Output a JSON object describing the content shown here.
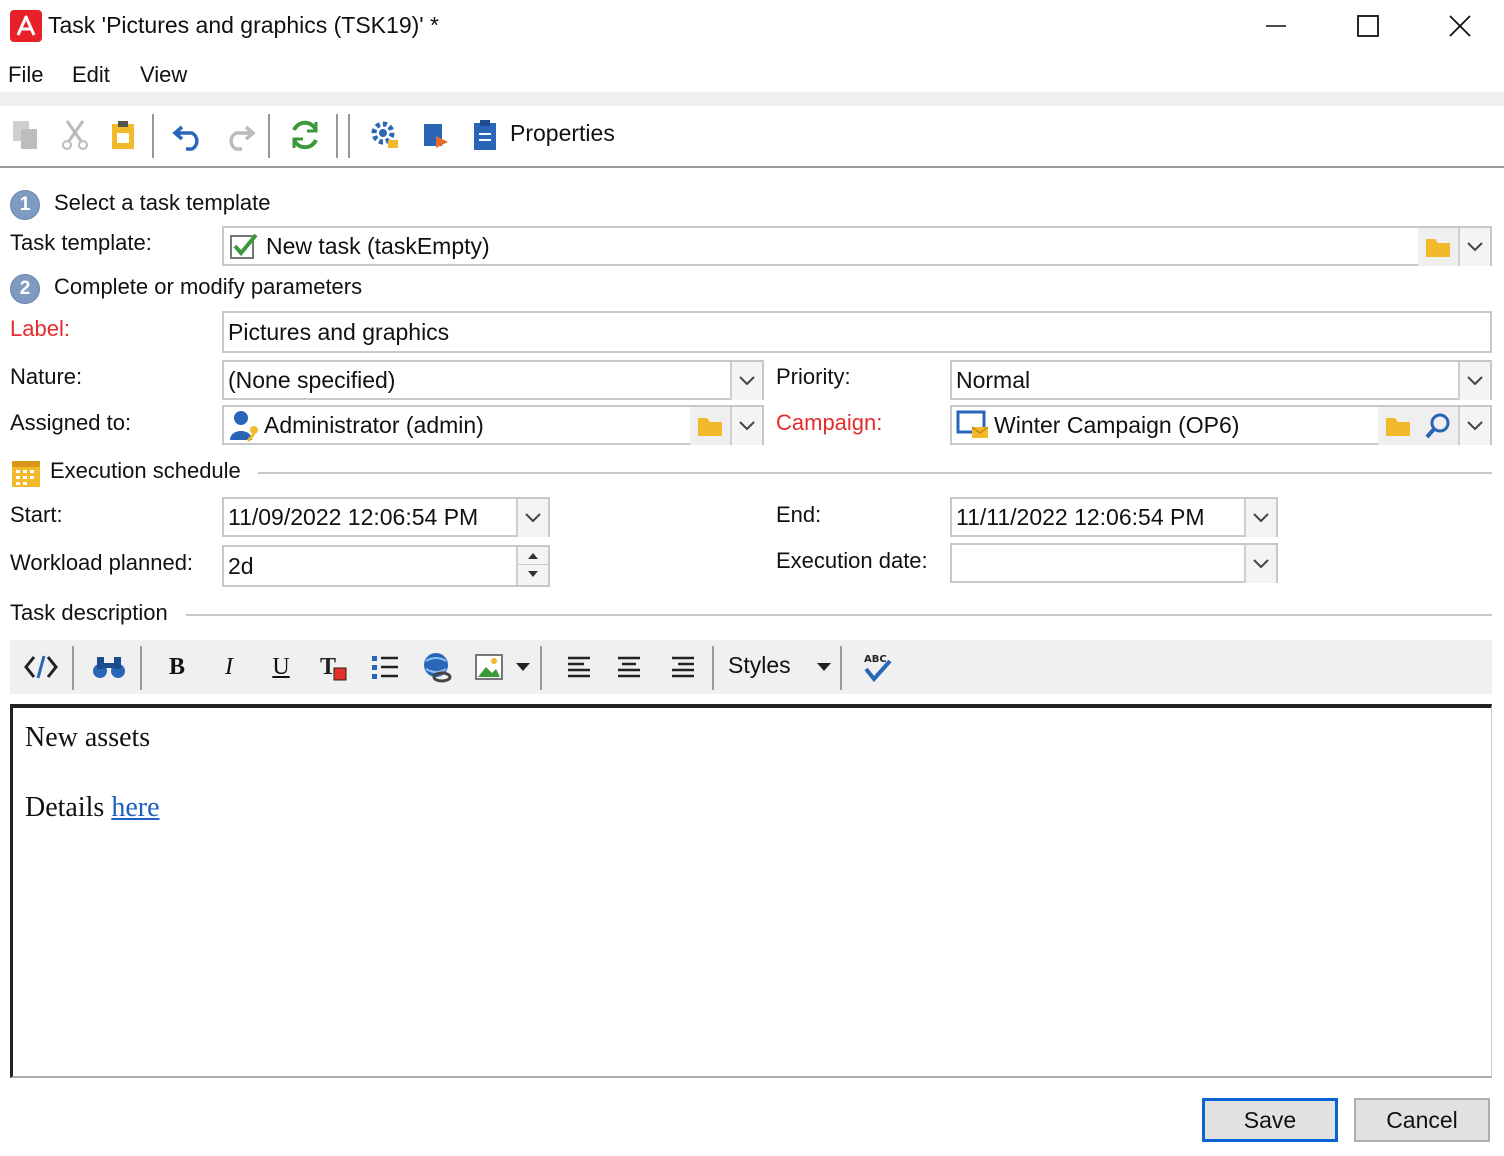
{
  "window": {
    "title": "Task 'Pictures and graphics (TSK19)' *"
  },
  "menu": [
    "File",
    "Edit",
    "View"
  ],
  "toolbar": {
    "properties_label": "Properties"
  },
  "step1": {
    "number": "1",
    "label": "Select a task template"
  },
  "task_template": {
    "label": "Task template:",
    "value": "New task (taskEmpty)"
  },
  "step2": {
    "number": "2",
    "label": "Complete or modify parameters"
  },
  "label_field": {
    "label": "Label:",
    "value": "Pictures and graphics"
  },
  "nature": {
    "label": "Nature:",
    "value": "(None specified)"
  },
  "priority": {
    "label": "Priority:",
    "value": "Normal"
  },
  "assigned_to": {
    "label": "Assigned to:",
    "value": "Administrator (admin)"
  },
  "campaign": {
    "label": "Campaign:",
    "value": "Winter Campaign (OP6)"
  },
  "schedule": {
    "title": "Execution schedule",
    "start_label": "Start:",
    "start_value": "11/09/2022 12:06:54 PM",
    "end_label": "End:",
    "end_value": "11/11/2022 12:06:54 PM",
    "workload_label": "Workload planned:",
    "workload_value": "2d",
    "execution_label": "Execution date:",
    "execution_value": ""
  },
  "description": {
    "title": "Task description",
    "styles_label": "Styles",
    "line1": "New assets",
    "line2_prefix": "Details",
    "link_text": "here"
  },
  "buttons": {
    "save": "Save",
    "cancel": "Cancel"
  },
  "colors": {
    "accent": "#0b62d2",
    "required": "#e52b2b",
    "brand": "#e8202a"
  }
}
